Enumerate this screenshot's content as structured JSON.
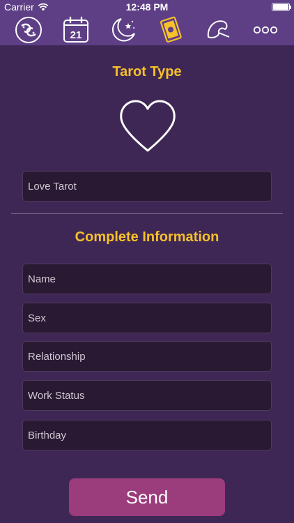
{
  "status_bar": {
    "carrier": "Carrier",
    "time": "12:48 PM",
    "battery_level": 1.0
  },
  "toolbar": {
    "items": [
      {
        "icon": "pisces-zodiac-icon",
        "active": false
      },
      {
        "icon": "calendar-icon",
        "label": "21",
        "active": false
      },
      {
        "icon": "moon-stars-icon",
        "active": false
      },
      {
        "icon": "tarot-card-icon",
        "active": true
      },
      {
        "icon": "fortune-cookie-icon",
        "active": false
      },
      {
        "icon": "more-icon",
        "active": false
      }
    ]
  },
  "tarot_section": {
    "title": "Tarot Type",
    "icon": "heart-icon",
    "selected_type": "Love Tarot"
  },
  "info_section": {
    "title": "Complete Information",
    "fields": [
      {
        "placeholder": "Name",
        "value": ""
      },
      {
        "placeholder": "Sex",
        "value": ""
      },
      {
        "placeholder": "Relationship",
        "value": ""
      },
      {
        "placeholder": "Work Status",
        "value": ""
      },
      {
        "placeholder": "Birthday",
        "value": ""
      }
    ]
  },
  "send_button": {
    "label": "Send"
  },
  "colors": {
    "background": "#3f2755",
    "toolbar": "#5e3f86",
    "accent": "#f6c12a",
    "field_background": "#2a1932",
    "send_button": "#9b3c7c"
  }
}
